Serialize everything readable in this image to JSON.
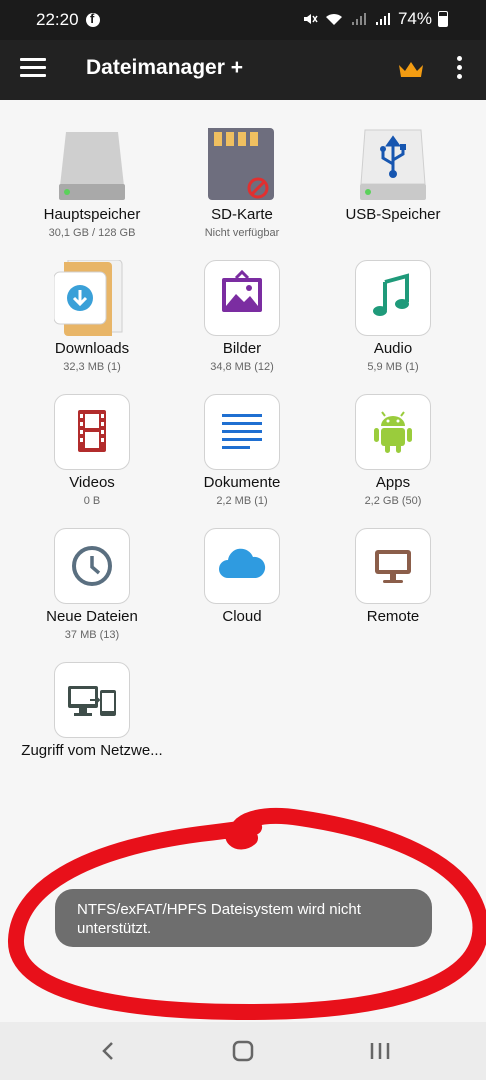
{
  "status_bar": {
    "time": "22:20",
    "battery": "74%"
  },
  "app_bar": {
    "title": "Dateimanager +"
  },
  "tiles": [
    {
      "label": "Hauptspeicher",
      "sub": "30,1 GB / 128 GB",
      "icon": "hard-drive-icon"
    },
    {
      "label": "SD-Karte",
      "sub": "Nicht verfügbar",
      "icon": "sd-card-icon"
    },
    {
      "label": "USB-Speicher",
      "sub": "",
      "icon": "usb-drive-icon"
    },
    {
      "label": "Downloads",
      "sub": "32,3 MB (1)",
      "icon": "downloads-icon"
    },
    {
      "label": "Bilder",
      "sub": "34,8 MB (12)",
      "icon": "image-icon"
    },
    {
      "label": "Audio",
      "sub": "5,9 MB (1)",
      "icon": "music-note-icon"
    },
    {
      "label": "Videos",
      "sub": "0 B",
      "icon": "film-icon"
    },
    {
      "label": "Dokumente",
      "sub": "2,2 MB (1)",
      "icon": "document-icon"
    },
    {
      "label": "Apps",
      "sub": "2,2 GB (50)",
      "icon": "android-icon"
    },
    {
      "label": "Neue Dateien",
      "sub": "37 MB (13)",
      "icon": "clock-icon"
    },
    {
      "label": "Cloud",
      "sub": "",
      "icon": "cloud-icon"
    },
    {
      "label": "Remote",
      "sub": "",
      "icon": "monitor-icon"
    },
    {
      "label": "Zugriff vom Netzwe...",
      "sub": "",
      "icon": "network-devices-icon"
    }
  ],
  "toast": {
    "message": "NTFS/exFAT/HPFS Dateisystem wird nicht unterstützt."
  },
  "colors": {
    "accent": "#f39c12",
    "app_bar": "#222222",
    "annotation": "#e8101a"
  }
}
